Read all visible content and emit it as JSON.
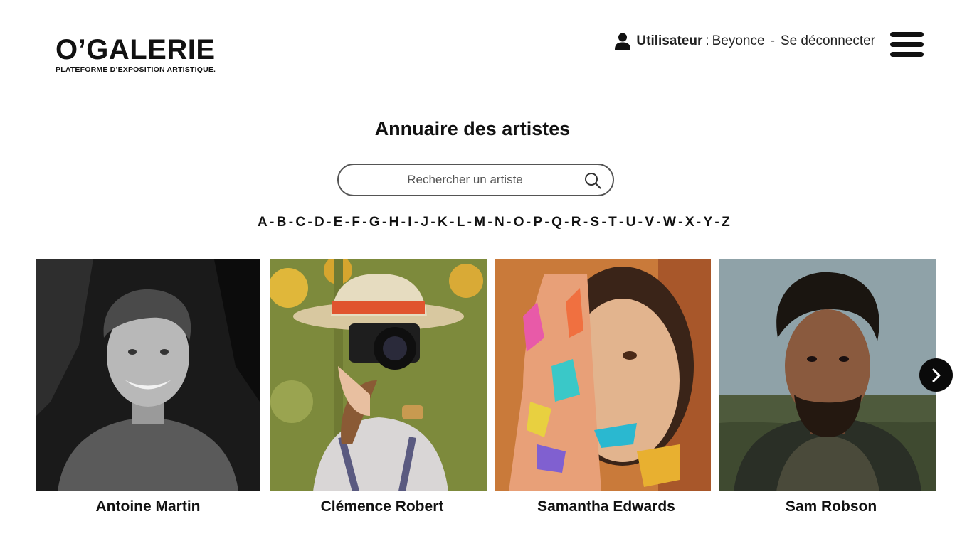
{
  "logo": {
    "title": "O’GALERIE",
    "subtitle": "PLATEFORME D’EXPOSITION ARTISTIQUE."
  },
  "user": {
    "label": "Utilisateur",
    "separator": ":",
    "name": "Beyonce",
    "dash": "-",
    "logout": "Se déconnecter"
  },
  "page": {
    "title": "Annuaire des artistes"
  },
  "search": {
    "placeholder": "Rechercher un artiste",
    "value": ""
  },
  "alphabet": [
    "A",
    "B",
    "C",
    "D",
    "E",
    "F",
    "G",
    "H",
    "I",
    "J",
    "K",
    "L",
    "M",
    "N",
    "O",
    "P",
    "Q",
    "R",
    "S",
    "T",
    "U",
    "V",
    "W",
    "X",
    "Y",
    "Z"
  ],
  "artists": [
    {
      "name": "Antoine Martin"
    },
    {
      "name": "Clémence Robert"
    },
    {
      "name": "Samantha Edwards"
    },
    {
      "name": "Sam Robson"
    }
  ],
  "colors": {
    "text": "#111111",
    "button_bg": "#0a0a0a",
    "border": "#555555"
  },
  "icons": {
    "user": "user-icon",
    "menu": "hamburger-menu-icon",
    "search": "search-icon",
    "next": "chevron-right-icon"
  }
}
